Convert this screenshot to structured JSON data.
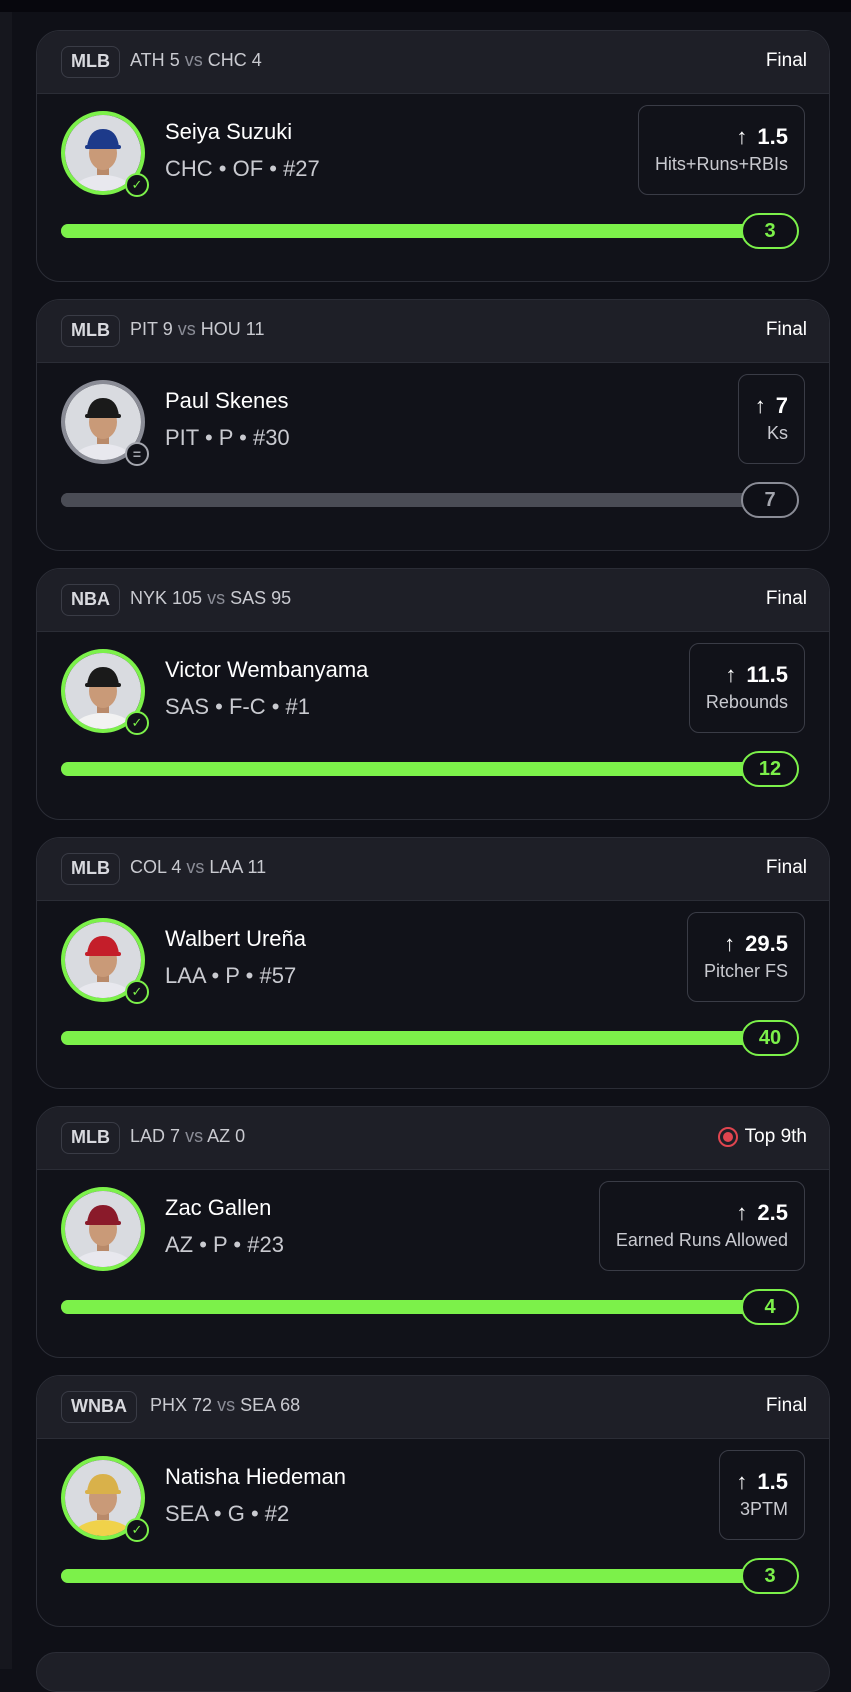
{
  "colors": {
    "background": "#0f1017",
    "card": "#111219",
    "header": "#1e1f27",
    "hit": "#7cf14a",
    "neutral": "#8a8c96",
    "live": "#e0454f"
  },
  "cards": [
    {
      "league": "MLB",
      "away_team": "ATH",
      "away_score": "5",
      "vs": "vs",
      "home_team": "CHC",
      "home_score": "4",
      "status": "Final",
      "live": false,
      "player_name": "Seiya Suzuki",
      "player_meta": "CHC • OF • #27",
      "line_arrow": "↑",
      "line_value": "1.5",
      "stat": "Hits+Runs+RBIs",
      "result": "3",
      "progress": 1.0,
      "outcome": "hit",
      "badge_icon": "check-icon",
      "badge_glyph": "✓",
      "cap_color": "#1d3a8a",
      "jersey_color": "#e8e8ee"
    },
    {
      "league": "MLB",
      "away_team": "PIT",
      "away_score": "9",
      "vs": "vs",
      "home_team": "HOU",
      "home_score": "11",
      "status": "Final",
      "live": false,
      "player_name": "Paul Skenes",
      "player_meta": "PIT • P • #30",
      "line_arrow": "↑",
      "line_value": "7",
      "stat": "Ks",
      "result": "7",
      "progress": 1.0,
      "outcome": "push",
      "badge_icon": "equals-icon",
      "badge_glyph": "=",
      "cap_color": "#1a1a1a",
      "jersey_color": "#e8e8ee"
    },
    {
      "league": "NBA",
      "away_team": "NYK",
      "away_score": "105",
      "vs": "vs",
      "home_team": "SAS",
      "home_score": "95",
      "status": "Final",
      "live": false,
      "player_name": "Victor Wembanyama",
      "player_meta": "SAS • F-C • #1",
      "line_arrow": "↑",
      "line_value": "11.5",
      "stat": "Rebounds",
      "result": "12",
      "progress": 1.0,
      "outcome": "hit",
      "badge_icon": "check-icon",
      "badge_glyph": "✓",
      "cap_color": "#1a1a1a",
      "jersey_color": "#f2f2f2"
    },
    {
      "league": "MLB",
      "away_team": "COL",
      "away_score": "4",
      "vs": "vs",
      "home_team": "LAA",
      "home_score": "11",
      "status": "Final",
      "live": false,
      "player_name": "Walbert Ureña",
      "player_meta": "LAA • P • #57",
      "line_arrow": "↑",
      "line_value": "29.5",
      "stat": "Pitcher FS",
      "result": "40",
      "progress": 1.0,
      "outcome": "hit",
      "badge_icon": "check-icon",
      "badge_glyph": "✓",
      "cap_color": "#c41e2a",
      "jersey_color": "#e8e8ee"
    },
    {
      "league": "MLB",
      "away_team": "LAD",
      "away_score": "7",
      "vs": "vs",
      "home_team": "AZ",
      "home_score": "0",
      "status": "Top 9th",
      "live": true,
      "player_name": "Zac Gallen",
      "player_meta": "AZ • P • #23",
      "line_arrow": "↑",
      "line_value": "2.5",
      "stat": "Earned Runs Allowed",
      "result": "4",
      "progress": 1.0,
      "outcome": "hit",
      "badge_icon": "",
      "badge_glyph": "",
      "cap_color": "#8a1a2a",
      "jersey_color": "#e8e8ee"
    },
    {
      "league": "WNBA",
      "away_team": "PHX",
      "away_score": "72",
      "vs": "vs",
      "home_team": "SEA",
      "home_score": "68",
      "status": "Final",
      "live": false,
      "player_name": "Natisha Hiedeman",
      "player_meta": "SEA • G • #2",
      "line_arrow": "↑",
      "line_value": "1.5",
      "stat": "3PTM",
      "result": "3",
      "progress": 1.0,
      "outcome": "hit",
      "badge_icon": "check-icon",
      "badge_glyph": "✓",
      "cap_color": "#d9b14a",
      "jersey_color": "#f0d24a"
    }
  ]
}
